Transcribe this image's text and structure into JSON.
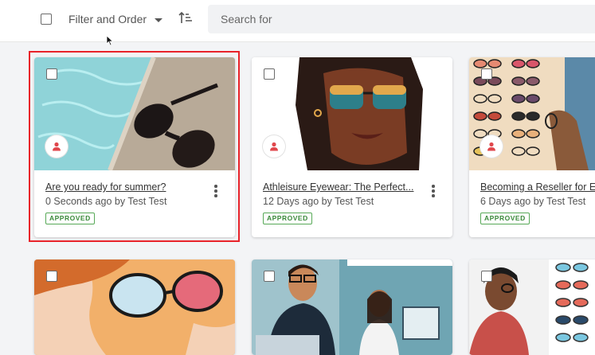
{
  "toolbar": {
    "filter_label": "Filter and Order",
    "search_placeholder": "Search for"
  },
  "cards": [
    {
      "title": "Are you ready for summer?",
      "meta": "0 Seconds ago by Test Test",
      "status": "APPROVED"
    },
    {
      "title": "Athleisure Eyewear: The Perfect...",
      "meta": "12 Days ago by Test Test",
      "status": "APPROVED"
    },
    {
      "title": "Becoming a Reseller for E",
      "meta": "6 Days ago by Test Test",
      "status": "APPROVED"
    }
  ],
  "colors": {
    "highlight": "#e8232a",
    "approved": "#3a8a3a",
    "avatar_icon": "#e0474c"
  }
}
